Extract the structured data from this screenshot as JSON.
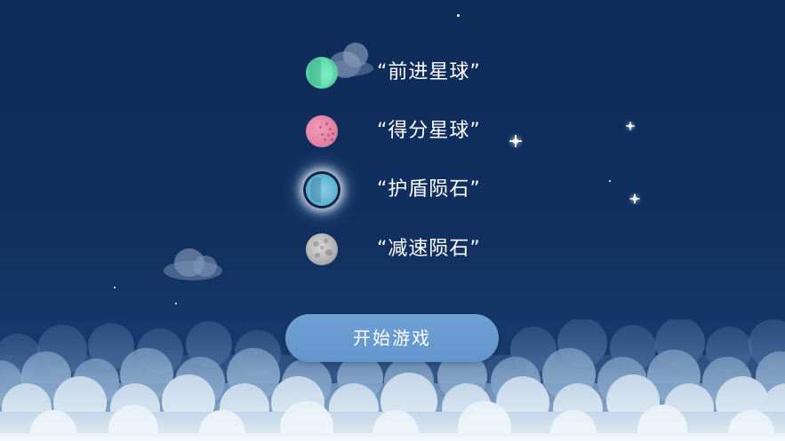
{
  "legend": [
    {
      "planet": "green-planet-icon",
      "color": "#5fdcae",
      "label": "“前进星球”"
    },
    {
      "planet": "pink-planet-icon",
      "color": "#e07ea0",
      "label": "“得分星球”"
    },
    {
      "planet": "shield-meteor-icon",
      "color": "#5aaed0",
      "label": "“护盾陨石”"
    },
    {
      "planet": "grey-meteor-icon",
      "color": "#b4b4b4",
      "label": "“减速陨石”"
    }
  ],
  "start_button": {
    "label": "开始游戏",
    "color": "#6395cc"
  },
  "background_color": "#0f2d5c"
}
